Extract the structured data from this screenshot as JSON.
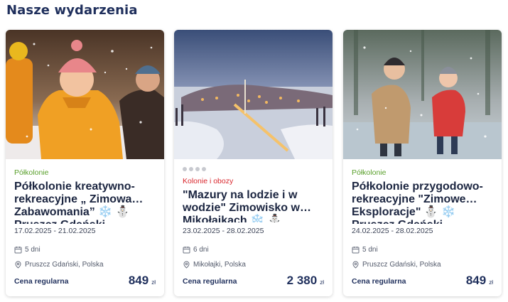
{
  "section_title": "Nasze wydarzenia",
  "cards": [
    {
      "category": "Półkolonie",
      "title": "Półkolonie kreatywno-rekreacyjne „ Zimowa… Zabawomania” ❄️ ⛄ Pruszcz Gdański",
      "dates": "17.02.2025 - 21.02.2025",
      "duration": "5 dni",
      "location": "Pruszcz Gdański, Polska",
      "price_label": "Cena regularna",
      "price": "849",
      "currency": "zł"
    },
    {
      "category": "Kolonie i obozy",
      "title": "\"Mazury na lodzie i w wodzie\" Zimowisko w… Mikołajkach ❄️ ⛄",
      "dates": "23.02.2025 - 28.02.2025",
      "duration": "6 dni",
      "location": "Mikołajki, Polska",
      "price_label": "Cena regularna",
      "price": "2 380",
      "currency": "zł"
    },
    {
      "category": "Półkolonie",
      "title": "Półkolonie przygodowo-rekreacyjne \"Zimowe… Eksploracje\" ⛄ ❄️ Pruszcz Gdański",
      "dates": "24.02.2025 - 28.02.2025",
      "duration": "5 dni",
      "location": "Pruszcz Gdański, Polska",
      "price_label": "Cena regularna",
      "price": "849",
      "currency": "zł"
    }
  ],
  "colors": {
    "heading": "#1f2f5c",
    "category_green": "#5aa02c",
    "category_red": "#d9262c"
  },
  "icons": {
    "duration": "calendar-icon",
    "location": "location-pin-icon"
  }
}
